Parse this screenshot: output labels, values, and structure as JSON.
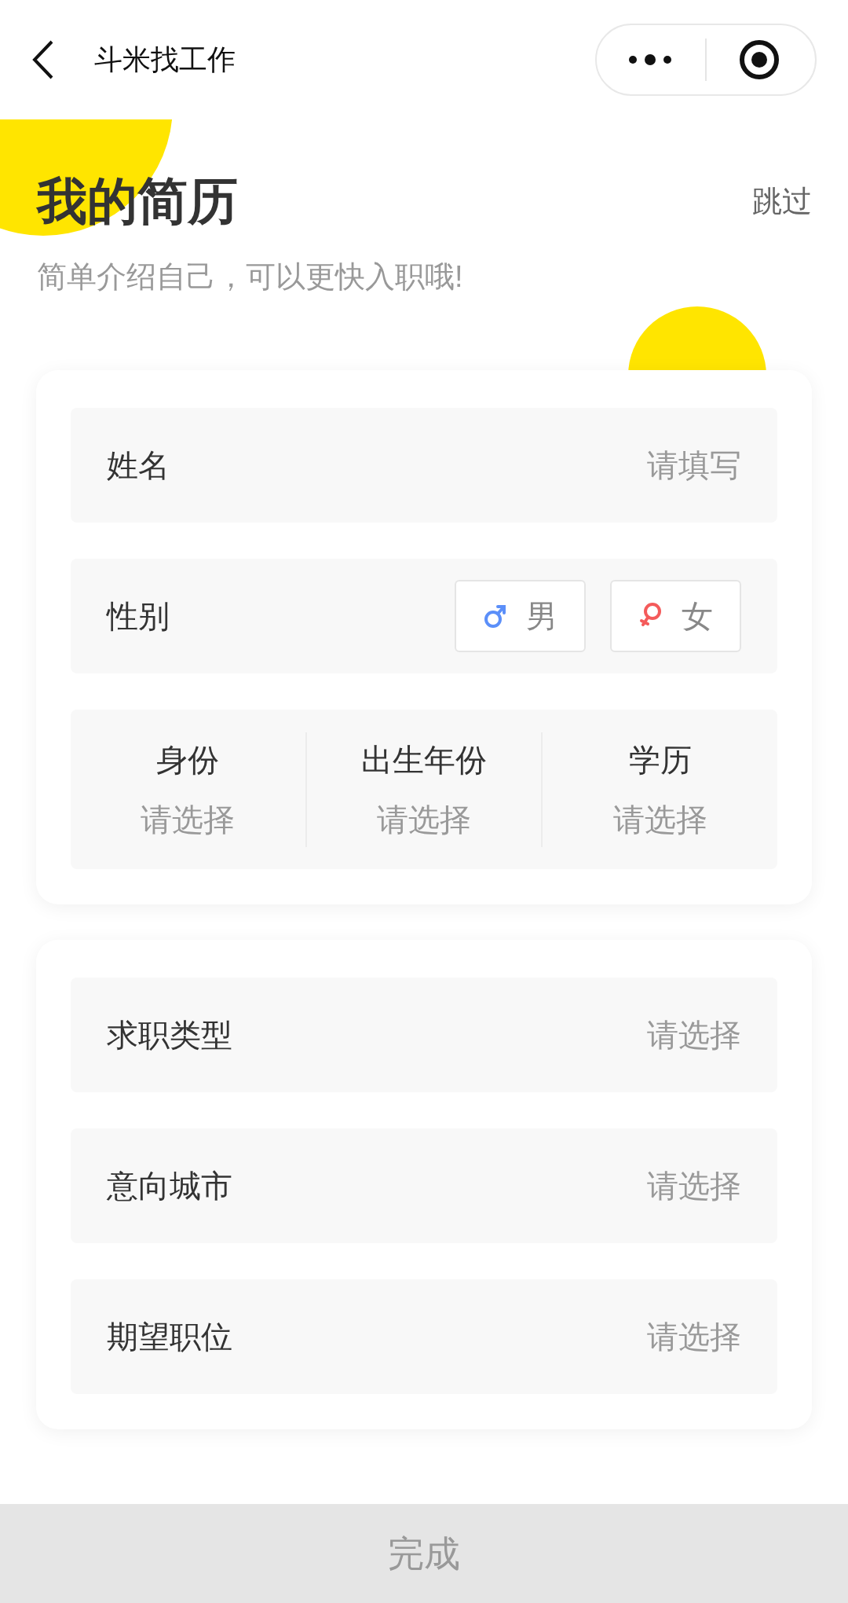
{
  "nav": {
    "title": "斗米找工作"
  },
  "header": {
    "title": "我的简历",
    "skip": "跳过",
    "subtitle": "简单介绍自己，可以更快入职哦!"
  },
  "basic": {
    "name": {
      "label": "姓名",
      "placeholder": "请填写"
    },
    "gender": {
      "label": "性别",
      "options": [
        {
          "kind": "male",
          "label": "男",
          "selected": false
        },
        {
          "kind": "female",
          "label": "女",
          "selected": false
        }
      ]
    },
    "pickers": [
      {
        "label": "身份",
        "placeholder": "请选择"
      },
      {
        "label": "出生年份",
        "placeholder": "请选择"
      },
      {
        "label": "学历",
        "placeholder": "请选择"
      }
    ]
  },
  "intent": [
    {
      "label": "求职类型",
      "placeholder": "请选择"
    },
    {
      "label": "意向城市",
      "placeholder": "请选择"
    },
    {
      "label": "期望职位",
      "placeholder": "请选择"
    }
  ],
  "submit": "完成"
}
